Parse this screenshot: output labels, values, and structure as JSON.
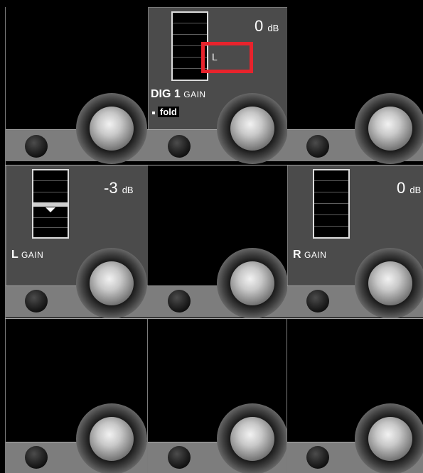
{
  "channels": {
    "dig1": {
      "level": "0",
      "level_unit": "dB",
      "name": "DIG 1",
      "param": "GAIN",
      "fold_label": "fold",
      "highlight_label": "L"
    },
    "left": {
      "level": "-3",
      "level_unit": "dB",
      "name": "L",
      "param": "GAIN"
    },
    "right": {
      "level": "0",
      "level_unit": "dB",
      "name": "R",
      "param": "GAIN"
    }
  },
  "colors": {
    "highlight": "#e8232c",
    "panel": "#4b4b4b",
    "strip": "#7d7d7d"
  },
  "icons": [
    "knob-icon",
    "small-knob-icon",
    "meter-icon",
    "fader-pointer-icon"
  ]
}
